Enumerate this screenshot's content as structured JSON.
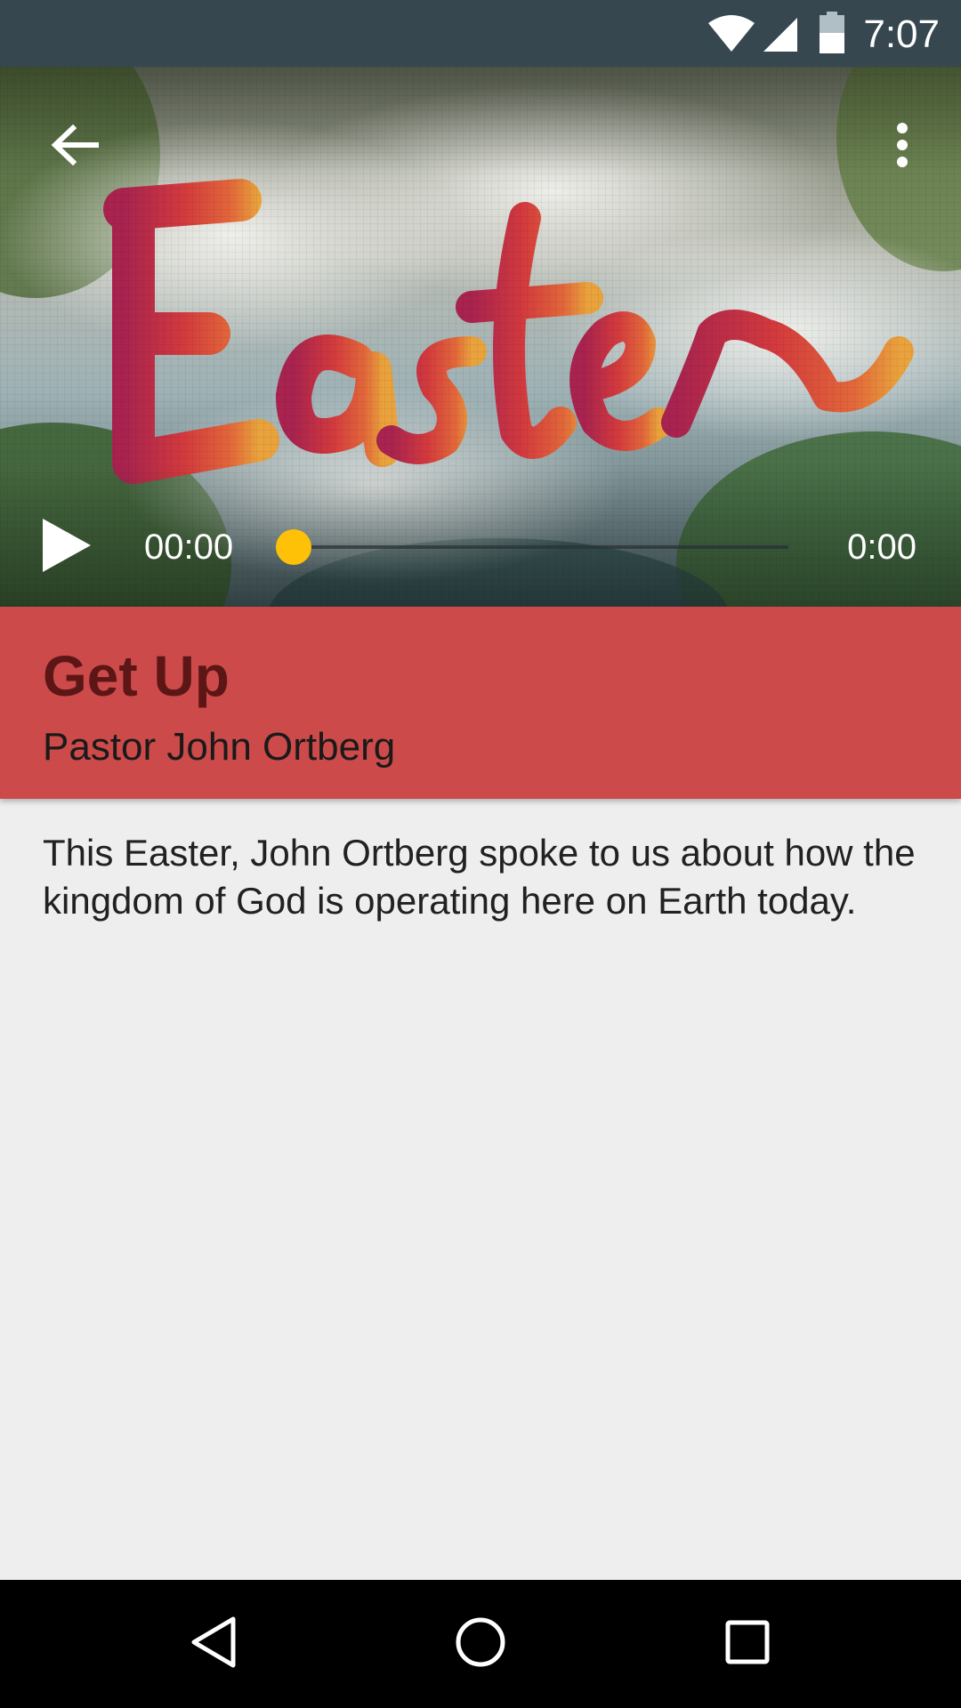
{
  "status_bar": {
    "time": "7:07",
    "icons": [
      "wifi-icon",
      "signal-icon",
      "battery-icon"
    ],
    "background": "#37474f"
  },
  "toolbar": {
    "back_icon": "arrow-back-icon",
    "more_icon": "more-vert-icon"
  },
  "hero": {
    "artwork_text": "Easter"
  },
  "player": {
    "play_icon": "play-icon",
    "elapsed": "00:00",
    "duration": "0:00",
    "progress": 0,
    "accent": "#ffc107"
  },
  "sermon": {
    "title": "Get Up",
    "speaker": "Pastor John Ortberg",
    "banner_color": "#cc4a4a",
    "title_color": "#5c1616"
  },
  "description": "This Easter, John Ortberg spoke to us about how the kingdom of God is operating here on Earth today.",
  "nav_bar": {
    "icons": [
      "nav-back-icon",
      "nav-home-icon",
      "nav-recents-icon"
    ]
  }
}
